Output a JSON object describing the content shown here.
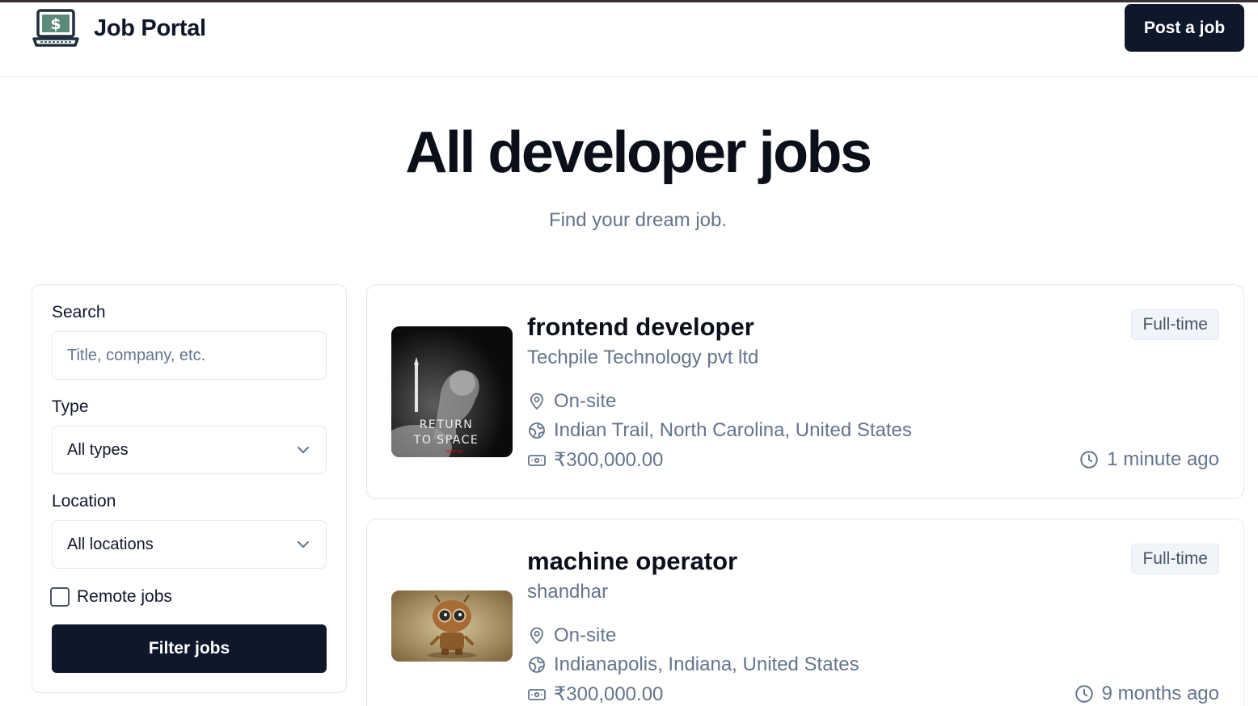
{
  "brand": {
    "name": "Job Portal",
    "logo_icon": "laptop-dollar-icon"
  },
  "header": {
    "post_job_label": "Post a job"
  },
  "hero": {
    "title": "All developer jobs",
    "subtitle": "Find your dream job."
  },
  "filters": {
    "search_label": "Search",
    "search_placeholder": "Title, company, etc.",
    "search_value": "",
    "type_label": "Type",
    "type_value": "All types",
    "location_label": "Location",
    "location_value": "All locations",
    "remote_label": "Remote jobs",
    "remote_checked": false,
    "submit_label": "Filter jobs"
  },
  "jobs": [
    {
      "title": "frontend developer",
      "company": "Techpile Technology pvt ltd",
      "location_type": "On-site",
      "location": "Indian Trail, North Carolina, United States",
      "salary": "₹300,000.00",
      "job_type": "Full-time",
      "posted": "1 minute ago",
      "logo": {
        "poster_line1": "RETURN",
        "poster_line2": "TO SPACE",
        "poster_brand": "NETFLIX"
      }
    },
    {
      "title": "machine operator",
      "company": "shandhar",
      "location_type": "On-site",
      "location": "Indianapolis, Indiana, United States",
      "salary": "₹300,000.00",
      "job_type": "Full-time",
      "posted": "9 months ago",
      "logo": {
        "subject": "robot-figure-image"
      }
    }
  ],
  "colors": {
    "primary": "#0f172a",
    "muted": "#64748b",
    "border": "#e5e7eb",
    "badge_bg": "#f1f5f9"
  }
}
